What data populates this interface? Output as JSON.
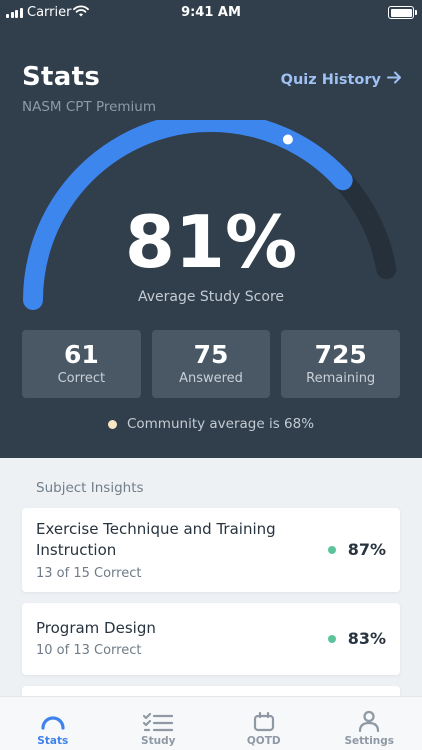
{
  "status_bar": {
    "carrier": "Carrier",
    "time": "9:41 AM"
  },
  "header": {
    "title": "Stats",
    "subtitle": "NASM CPT Premium",
    "quiz_history_label": "Quiz History"
  },
  "score": {
    "value": "81%",
    "label": "Average Study Score",
    "fraction": 0.81,
    "colors": {
      "progress": "#3d86ee",
      "track": "#25303b",
      "marker": "#ffffff"
    }
  },
  "stats": [
    {
      "value": "61",
      "label": "Correct"
    },
    {
      "value": "75",
      "label": "Answered"
    },
    {
      "value": "725",
      "label": "Remaining"
    }
  ],
  "community": {
    "text": "Community average is 68%",
    "fraction": 0.68
  },
  "insights": {
    "heading": "Subject Insights",
    "items": [
      {
        "name_line1": "Exercise Technique and Training",
        "name_line2": "Instruction",
        "detail": "13 of 15 Correct",
        "percent": "87%"
      },
      {
        "name_line1": "Program Design",
        "name_line2": "",
        "detail": "10 of 13 Correct",
        "percent": "83%"
      }
    ]
  },
  "tabs": [
    {
      "label": "Stats",
      "icon": "stats-arc-icon",
      "active": true
    },
    {
      "label": "Study",
      "icon": "checklist-icon",
      "active": false
    },
    {
      "label": "QOTD",
      "icon": "calendar-icon",
      "active": false
    },
    {
      "label": "Settings",
      "icon": "person-icon",
      "active": false
    }
  ]
}
